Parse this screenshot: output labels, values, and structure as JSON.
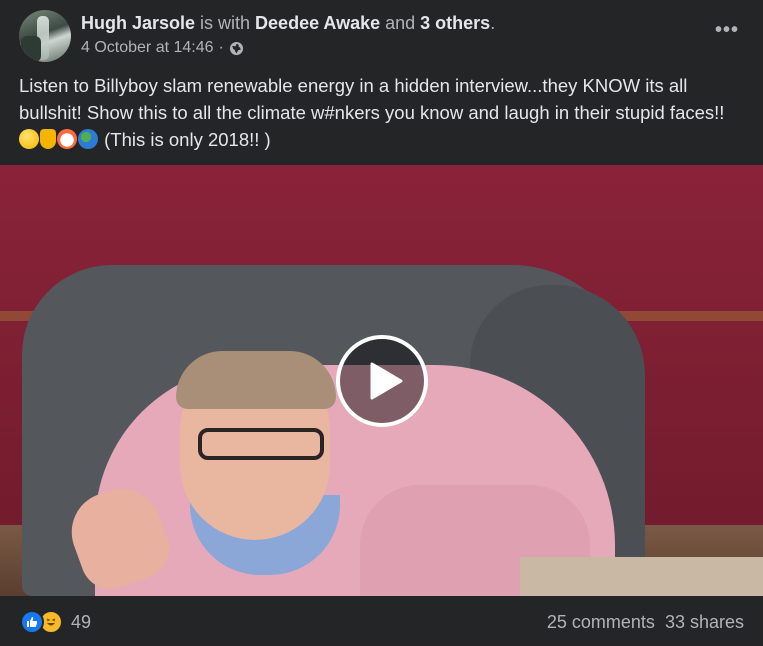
{
  "post": {
    "author": "Hugh Jarsole",
    "with_text": " is with ",
    "tagged_name": "Deedee Awake",
    "and_text": " and ",
    "others": "3 others",
    "period": ".",
    "timestamp": "4 October at 14:46",
    "dot": "·",
    "privacy_icon": "globe-icon",
    "more_icon": "ellipsis-icon",
    "text_part1": "Listen to Billyboy slam renewable energy in a hidden interview...they KNOW its all bullshit! Show this to all the climate w#nkers you know and laugh in their stupid faces!! ",
    "emojis": [
      "laughing-emoji",
      "thumbs-up-emoji",
      "clown-emoji",
      "earth-emoji"
    ],
    "text_part2": " (This is only 2018!! )"
  },
  "video": {
    "play_icon": "play-icon"
  },
  "footer": {
    "reaction_icons": [
      "like-icon",
      "haha-icon"
    ],
    "reaction_count": "49",
    "comments": "25 comments",
    "shares": "33 shares"
  },
  "colors": {
    "background": "#242526",
    "primary_text": "#e4e6eb",
    "secondary_text": "#b0b3b8",
    "like_blue": "#1877f2",
    "haha_yellow": "#f7b928"
  }
}
